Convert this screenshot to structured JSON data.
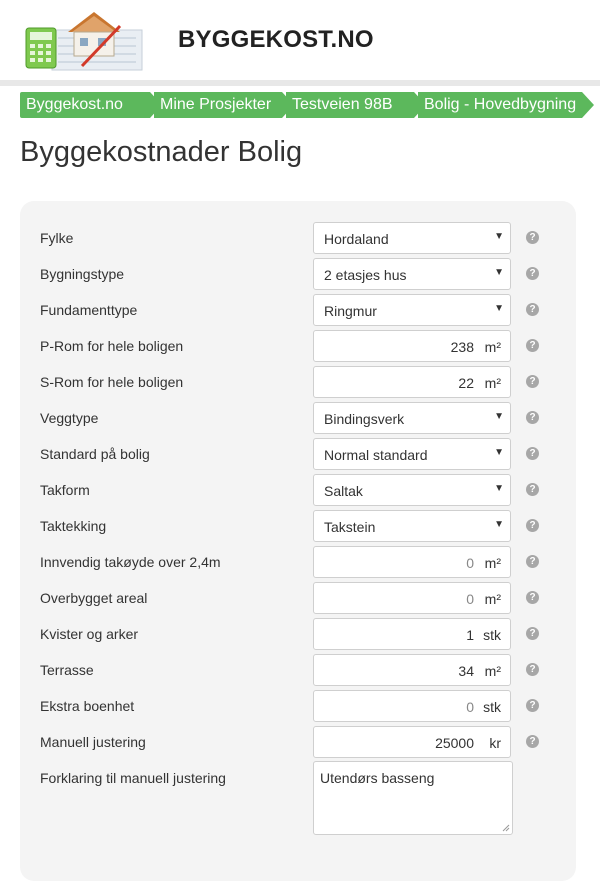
{
  "header": {
    "site_title": "BYGGEKOST.NO"
  },
  "breadcrumbs": [
    "Byggekost.no",
    "Mine Prosjekter",
    "Testveien 98B",
    "Bolig - Hovedbygning"
  ],
  "page_title": "Byggekostnader Bolig",
  "help_glyph": "?",
  "form": {
    "fylke": {
      "label": "Fylke",
      "value": "Hordaland"
    },
    "bygningstype": {
      "label": "Bygningstype",
      "value": "2 etasjes hus"
    },
    "fundamenttype": {
      "label": "Fundamenttype",
      "value": "Ringmur"
    },
    "p_rom": {
      "label": "P-Rom for hele boligen",
      "value": "238",
      "unit": "m²"
    },
    "s_rom": {
      "label": "S-Rom for hele boligen",
      "value": "22",
      "unit": "m²"
    },
    "veggtype": {
      "label": "Veggtype",
      "value": "Bindingsverk"
    },
    "standard": {
      "label": "Standard på bolig",
      "value": "Normal standard"
    },
    "takform": {
      "label": "Takform",
      "value": "Saltak"
    },
    "taktekking": {
      "label": "Taktekking",
      "value": "Takstein"
    },
    "takhoyde": {
      "label": "Innvendig takøyde over 2,4m",
      "value": "0",
      "unit": "m²"
    },
    "overbygget": {
      "label": "Overbygget areal",
      "value": "0",
      "unit": "m²"
    },
    "kvister": {
      "label": "Kvister og arker",
      "value": "1",
      "unit": "stk"
    },
    "terrasse": {
      "label": "Terrasse",
      "value": "34",
      "unit": "m²"
    },
    "ekstra": {
      "label": "Ekstra boenhet",
      "value": "0",
      "unit": "stk"
    },
    "manuell": {
      "label": "Manuell justering",
      "value": "25000",
      "unit": "kr"
    },
    "forklaring": {
      "label": "Forklaring til manuell justering",
      "value": "Utendørs basseng"
    }
  },
  "colors": {
    "breadcrumb_green": "#5cb85c",
    "panel_bg": "#f4f4f4",
    "help_icon": "#a7a7a7"
  }
}
